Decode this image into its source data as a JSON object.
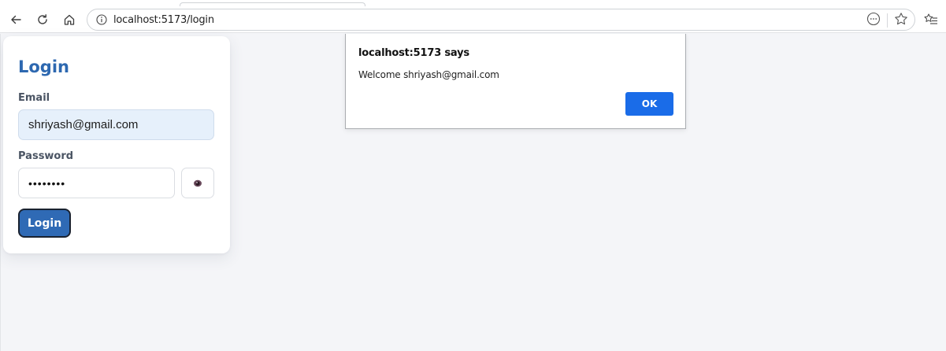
{
  "browser": {
    "url": "localhost:5173/login",
    "icons": {
      "back": "back-arrow-icon",
      "refresh": "refresh-icon",
      "home": "home-icon",
      "site_info": "info-icon",
      "reader": "more-icon",
      "favorite": "star-icon",
      "favorites_list": "favorites-list-icon"
    }
  },
  "login": {
    "title": "Login",
    "email_label": "Email",
    "email_value": "shriyash@gmail.com",
    "password_label": "Password",
    "password_value": "••••••••",
    "toggle_icon": "eye-icon",
    "submit_label": "Login"
  },
  "alert": {
    "title": "localhost:5173 says",
    "message": "Welcome shriyash@gmail.com",
    "ok_label": "OK"
  },
  "colors": {
    "accent": "#2d68b0",
    "dialog_button": "#1a6ce8",
    "page_background": "#f4f5f8",
    "email_field_background": "#e6f0fb"
  }
}
